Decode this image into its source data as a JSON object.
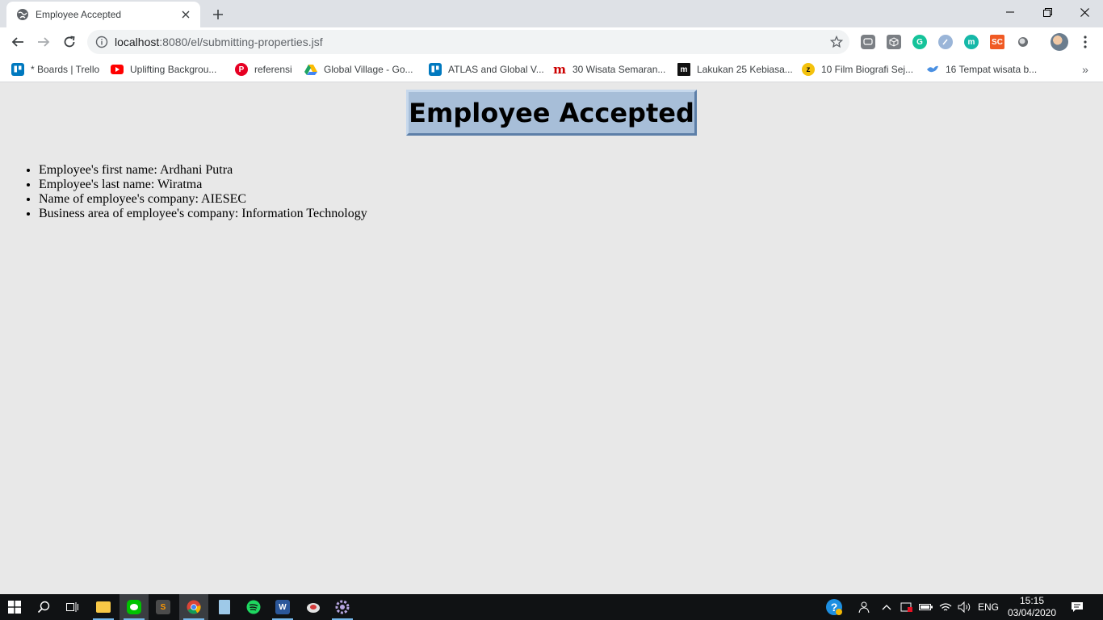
{
  "browser": {
    "tab": {
      "title": "Employee Accepted"
    },
    "address": {
      "host": "localhost",
      "rest": ":8080/el/submitting-properties.jsf"
    },
    "bookmarks": [
      {
        "label": "* Boards | Trello",
        "icon": "trello-icon",
        "color": "#0079bf"
      },
      {
        "label": "Uplifting Backgrou...",
        "icon": "youtube-icon",
        "color": "#ff0000"
      },
      {
        "label": "referensi",
        "icon": "pinterest-icon",
        "color": "#e60023"
      },
      {
        "label": "Global Village - Go...",
        "icon": "google-drive-icon",
        "color": "#1fa463"
      },
      {
        "label": "ATLAS and Global V...",
        "icon": "trello-icon",
        "color": "#0079bf"
      },
      {
        "label": "30 Wisata Semaran...",
        "icon": "m-icon",
        "color": "#cc0000"
      },
      {
        "label": "Lakukan 25 Kebiasa...",
        "icon": "m-icon",
        "color": "#111111"
      },
      {
        "label": "10 Film Biografi Sej...",
        "icon": "z-icon",
        "color": "#f4c20d"
      },
      {
        "label": "16 Tempat wisata b...",
        "icon": "bird-icon",
        "color": "#4a90e2"
      }
    ]
  },
  "page": {
    "heading": "Employee Accepted",
    "properties": [
      "Employee's first name: Ardhani Putra",
      "Employee's last name: Wiratma",
      "Name of employee's company: AIESEC",
      "Business area of employee's company: Information Technology"
    ]
  },
  "taskbar": {
    "language": "ENG",
    "time": "15:15",
    "date": "03/04/2020"
  },
  "colors": {
    "page_background": "#e8e8e8",
    "heading_background": "#a7bed8",
    "taskbar": "#101214",
    "accent": "#76b9ed"
  }
}
